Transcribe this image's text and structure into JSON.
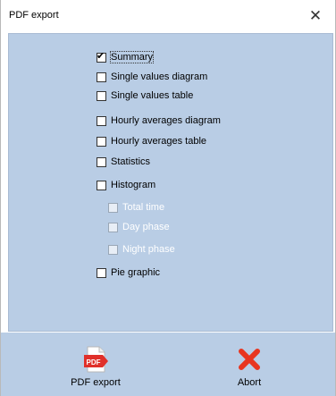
{
  "window": {
    "title": "PDF export",
    "close_symbol": "✕"
  },
  "options": [
    {
      "label": "Summary",
      "checked": true,
      "enabled": true,
      "focused": true
    },
    {
      "label": "Single values diagram",
      "checked": false,
      "enabled": true
    },
    {
      "label": "Single values table",
      "checked": false,
      "enabled": true
    },
    {
      "label": "Hourly averages diagram",
      "checked": false,
      "enabled": true
    },
    {
      "label": "Hourly averages table",
      "checked": false,
      "enabled": true
    },
    {
      "label": "Statistics",
      "checked": false,
      "enabled": true
    },
    {
      "label": "Histogram",
      "checked": false,
      "enabled": true
    },
    {
      "label": "Total time",
      "checked": false,
      "enabled": false
    },
    {
      "label": "Day phase",
      "checked": false,
      "enabled": false
    },
    {
      "label": "Night phase",
      "checked": false,
      "enabled": false
    },
    {
      "label": "Pie graphic",
      "checked": false,
      "enabled": true
    }
  ],
  "footer": {
    "pdf_export_label": "PDF export",
    "pdf_icon_text": "PDF",
    "abort_label": "Abort"
  },
  "colors": {
    "panel": "#b9cde5",
    "pdf_red": "#e0302a",
    "abort_red": "#e8351f"
  },
  "icons": {
    "close": "close-icon",
    "pdf": "pdf-file-icon",
    "abort": "abort-x-icon"
  }
}
